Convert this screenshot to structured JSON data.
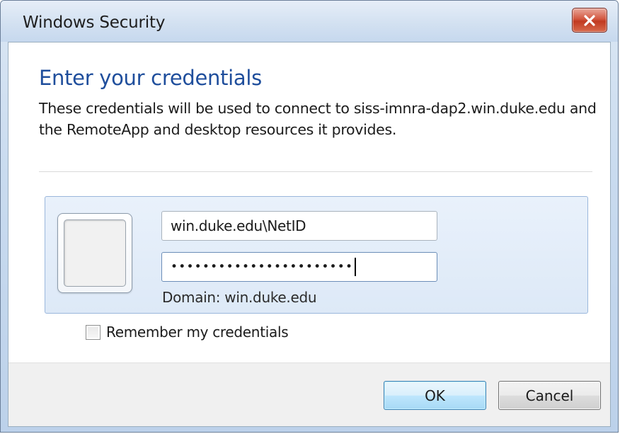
{
  "window": {
    "title": "Windows Security"
  },
  "dialog": {
    "heading": "Enter your credentials",
    "description": "These credentials will be used to connect to siss-imnra-dap2.win.duke.edu and the RemoteApp and desktop resources it provides."
  },
  "credentials": {
    "username_value": "win.duke.edu\\NetID",
    "password_mask": "•••••••••••••••••••••••",
    "domain_text": "Domain: win.duke.edu"
  },
  "remember": {
    "label": "Remember my credentials",
    "checked": false
  },
  "buttons": {
    "ok_label": "OK",
    "cancel_label": "Cancel"
  },
  "icons": {
    "close": "close-icon",
    "user_tile": "user-tile-icon"
  },
  "colors": {
    "heading": "#1f4e9c",
    "close_button": "#c13a21",
    "panel_border": "#9ab7dc"
  }
}
